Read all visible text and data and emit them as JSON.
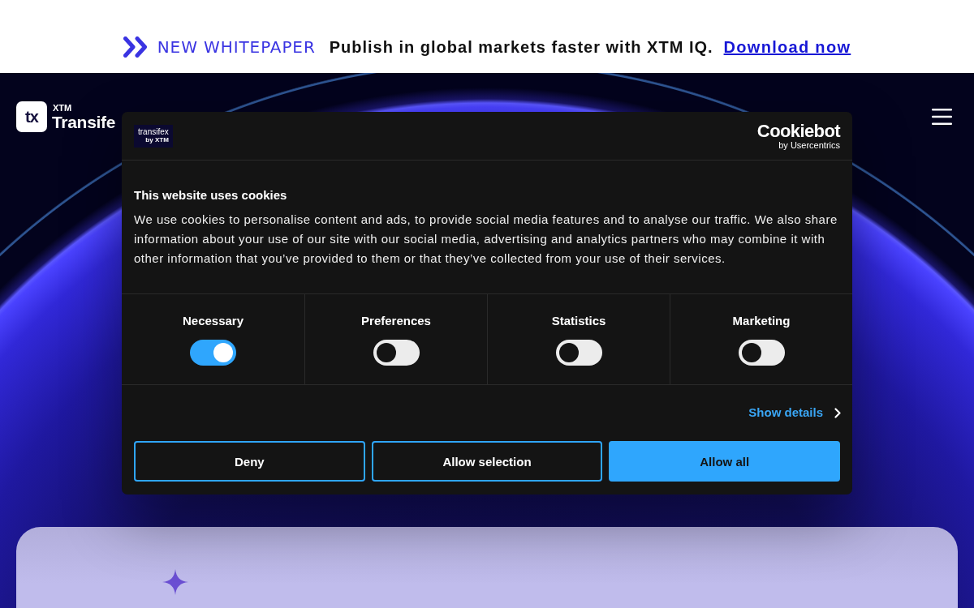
{
  "banner": {
    "tag": "NEW WHITEPAPER",
    "headline": "Publish in global markets faster with XTM IQ.",
    "link": "Download now"
  },
  "header": {
    "logo_mark": "tx",
    "logo_small": "XTM",
    "logo_name": "Transife"
  },
  "cookie_dialog": {
    "brand_logo": {
      "name": "transifex",
      "byline": "by XTM"
    },
    "provider_logo": {
      "name": "Cookiebot",
      "byline": "by Usercentrics"
    },
    "title": "This website uses cookies",
    "body": "We use cookies to personalise content and ads, to provide social media features and to analyse our traffic. We also share information about your use of our site with our social media, advertising and analytics partners who may combine it with other information that you’ve provided to them or that they’ve collected from your use of their services.",
    "categories": [
      {
        "label": "Necessary",
        "on": true
      },
      {
        "label": "Preferences",
        "on": false
      },
      {
        "label": "Statistics",
        "on": false
      },
      {
        "label": "Marketing",
        "on": false
      }
    ],
    "details_link": "Show details",
    "buttons": [
      {
        "label": "Deny",
        "kind": "outline"
      },
      {
        "label": "Allow selection",
        "kind": "outline"
      },
      {
        "label": "Allow all",
        "kind": "primary"
      }
    ]
  }
}
